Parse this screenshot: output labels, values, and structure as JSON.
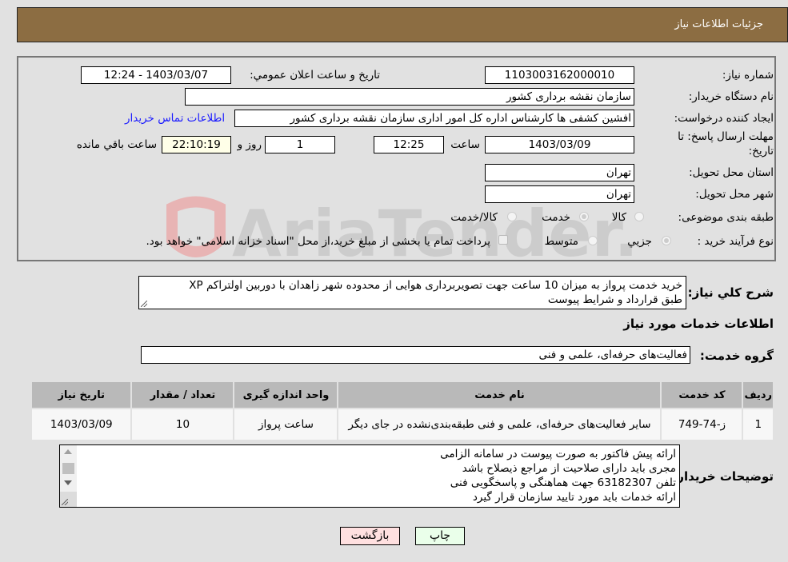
{
  "header": {
    "title": "جزئیات اطلاعات نیاز"
  },
  "fields": {
    "need_number": {
      "label": "شماره نیاز:",
      "value": "1103003162000010"
    },
    "announce_datetime": {
      "label": "تاریخ و ساعت اعلان عمومي:",
      "value": "1403/03/07 - 12:24"
    },
    "buyer_org": {
      "label": "نام دستگاه خریدار:",
      "value": "سازمان نقشه برداری کشور"
    },
    "requester": {
      "label": "ایجاد کننده درخواست:",
      "value": "افشین کشفی ها کارشناس اداره کل امور اداری سازمان نقشه برداری کشور"
    },
    "buyer_contact_link": "اطلاعات تماس خریدار",
    "deadline": {
      "label_line1": "مهلت ارسال پاسخ: تا",
      "label_line2": "تاریخ:",
      "date": "1403/03/09",
      "time_label": "ساعت",
      "time": "12:25",
      "days": "1",
      "days_label": "روز و",
      "remaining": "22:10:19",
      "remaining_label": "ساعت باقي مانده"
    },
    "province": {
      "label": "استان محل تحویل:",
      "value": "تهران"
    },
    "city": {
      "label": "شهر محل تحویل:",
      "value": "تهران"
    },
    "category": {
      "label": "طبقه بندی موضوعی:",
      "options": [
        "کالا",
        "خدمت",
        "کالا/خدمت"
      ],
      "selected": "خدمت"
    },
    "purchase_type": {
      "label": "نوع فرآیند خرید :",
      "options": [
        "جزیي",
        "متوسط"
      ],
      "selected": "جزیي",
      "treasury_note": "پرداخت تمام یا بخشی از مبلغ خرید،از محل \"اسناد خزانه اسلامی\" خواهد بود."
    }
  },
  "description": {
    "label": "شرح کلي نیاز:",
    "line1": "خرید خدمت پرواز به میزان 10 ساعت جهت تصویربرداری هوایی از محدوده شهر زاهدان با دوربین اولتراکم XP",
    "line2": "طبق قرارداد و شرایط پیوست"
  },
  "services_section": {
    "title": "اطلاعات خدمات مورد نیاز",
    "group_label": "گروه خدمت:",
    "group_value": "فعالیت‌های حرفه‌ای، علمی و فنی"
  },
  "table": {
    "headers": [
      "ردیف",
      "کد خدمت",
      "نام خدمت",
      "واحد اندازه گیری",
      "تعداد / مقدار",
      "تاریخ نیاز"
    ],
    "rows": [
      {
        "row": "1",
        "code": "ز-74-749",
        "name": "سایر فعالیت‌های حرفه‌ای، علمی و فنی طبقه‌بندی‌نشده در جای دیگر",
        "unit": "ساعت پرواز",
        "qty": "10",
        "date": "1403/03/09"
      }
    ]
  },
  "buyer_notes": {
    "label": "توضیحات خریدار:",
    "lines": [
      "ارائه پیش فاکتور به صورت پیوست در سامانه الزامی",
      "مجری باید دارای صلاحیت از مراجع ذیصلاح باشد",
      "تلفن 63182307  جهت هماهنگی و پاسخگویی فنی",
      "ارائه خدمات باید مورد تایید سازمان قرار گیرد"
    ]
  },
  "buttons": {
    "print": "چاپ",
    "back": "بازگشت"
  },
  "watermark": "AriaTender.neT",
  "colors": {
    "header_bg": "#8c6d42",
    "link": "#1a1aff",
    "print_bg": "#eaffea",
    "back_bg": "#ffe0e0",
    "remaining_bg": "#ffffe8"
  }
}
